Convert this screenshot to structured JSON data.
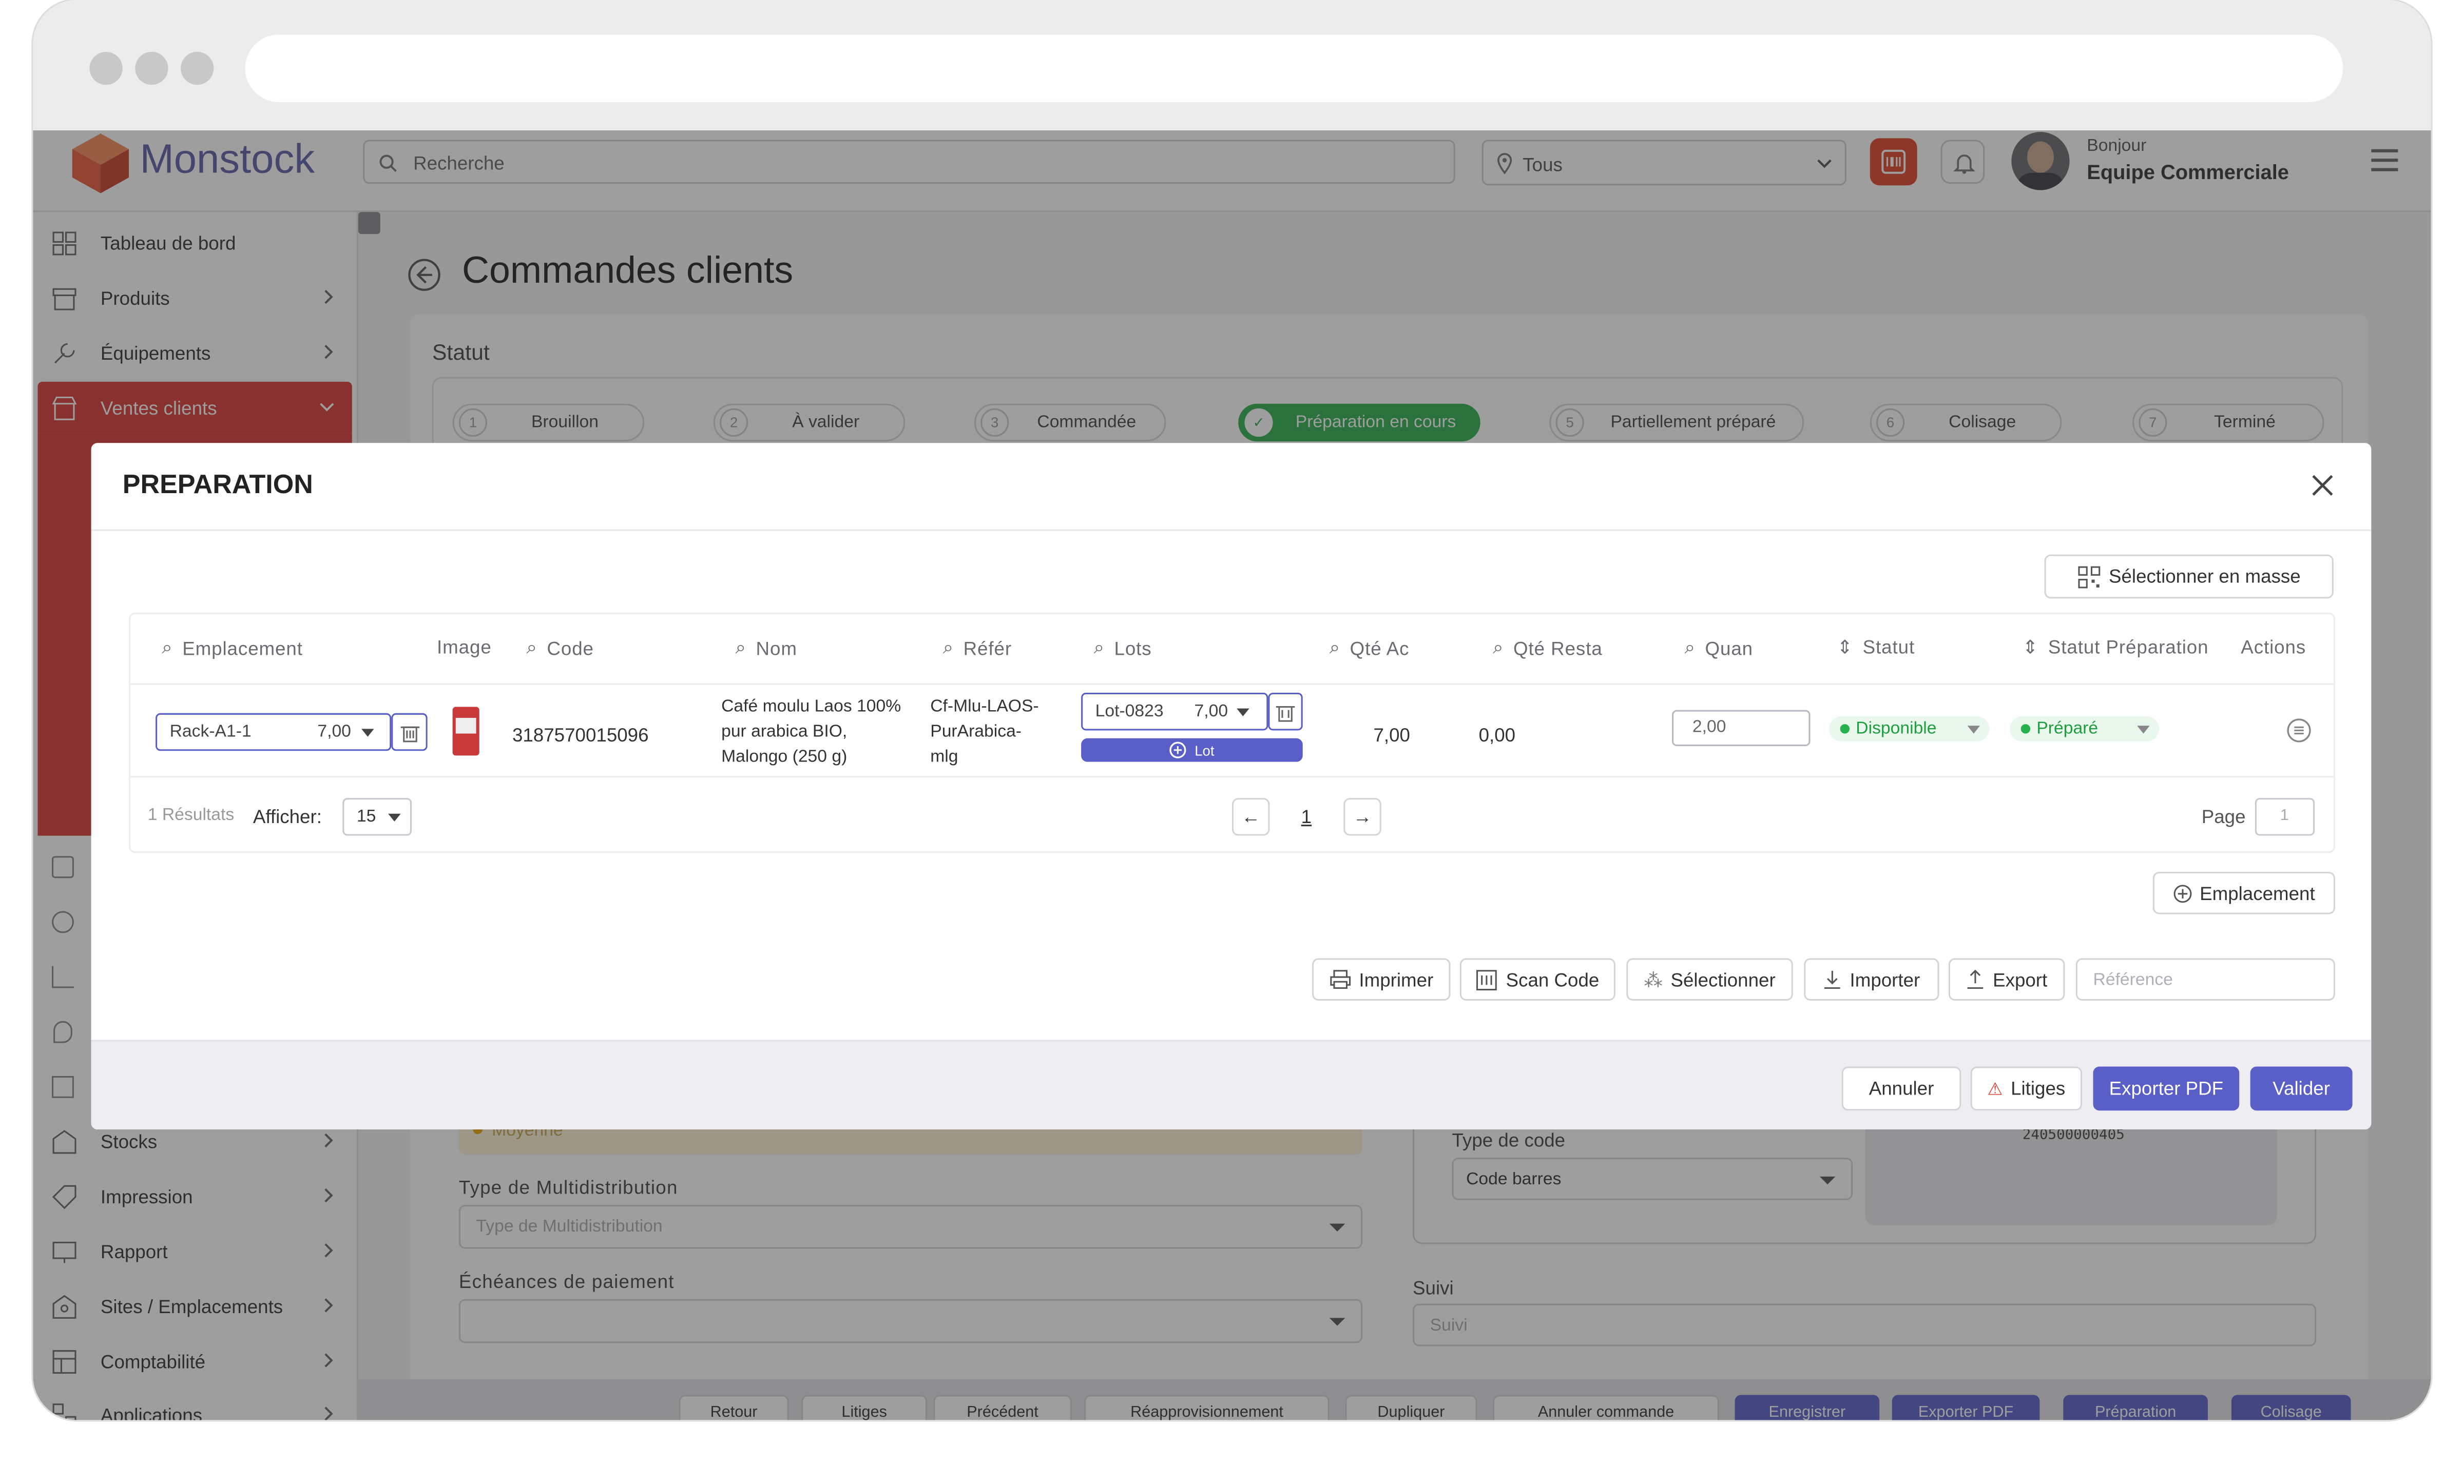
{
  "app": {
    "brand": "Monstock",
    "search_placeholder": "Recherche",
    "location_filter": "Tous",
    "greeting": "Bonjour",
    "user_name": "Equipe Commerciale"
  },
  "sidebar": {
    "items": [
      {
        "label": "Tableau de bord",
        "icon": "dashboard-icon"
      },
      {
        "label": "Produits",
        "icon": "box-icon"
      },
      {
        "label": "Équipements",
        "icon": "tools-icon"
      },
      {
        "label": "Ventes clients",
        "icon": "store-icon"
      },
      {
        "label": "Stocks",
        "icon": "warehouse-icon"
      },
      {
        "label": "Impression",
        "icon": "tag-icon"
      },
      {
        "label": "Rapport",
        "icon": "report-icon"
      },
      {
        "label": "Sites / Emplacements",
        "icon": "site-icon"
      },
      {
        "label": "Comptabilité",
        "icon": "accounting-icon"
      },
      {
        "label": "Applications",
        "icon": "apps-icon"
      }
    ]
  },
  "page": {
    "title": "Commandes clients",
    "status_label": "Statut"
  },
  "steps": [
    {
      "n": "1",
      "label": "Brouillon"
    },
    {
      "n": "2",
      "label": "À valider"
    },
    {
      "n": "3",
      "label": "Commandée"
    },
    {
      "n": "4",
      "label": "Préparation en cours"
    },
    {
      "n": "5",
      "label": "Partiellement préparé"
    },
    {
      "n": "6",
      "label": "Colisage"
    },
    {
      "n": "7",
      "label": "Terminé"
    }
  ],
  "background_form": {
    "priority_value": "Moyenne",
    "multi_label": "Type de Multidistribution",
    "multi_placeholder": "Type de Multidistribution",
    "echeances_label": "Échéances de paiement",
    "code_type_label": "Type de code",
    "code_type_value": "Code barres",
    "barcode_number": "240500000405",
    "suivi_label": "Suivi",
    "suivi_placeholder": "Suivi"
  },
  "bottom_bar": [
    "Retour",
    "Litiges",
    "Précédent",
    "Réapprovisionnement",
    "Dupliquer",
    "Annuler commande",
    "Enregistrer",
    "Exporter PDF",
    "Préparation",
    "Colisage"
  ],
  "modal": {
    "title": "PREPARATION",
    "select_mass": "Sélectionner en masse",
    "columns": {
      "emplacement": "Emplacement",
      "image": "Image",
      "code": "Code",
      "nom": "Nom",
      "refer": "Référ",
      "lots": "Lots",
      "qte_ac": "Qté Ac",
      "qte_resta": "Qté Resta",
      "quan": "Quan",
      "statut": "Statut",
      "statut_prep": "Statut Préparation",
      "actions": "Actions"
    },
    "row": {
      "emplacement": "Rack-A1-1",
      "emplacement_qty": "7,00",
      "code": "3187570015096",
      "nom_l1": "Café moulu Laos 100%",
      "nom_l2": "pur arabica BIO,",
      "nom_l3": "Malongo (250 g)",
      "ref_l1": "Cf-Mlu-LAOS-",
      "ref_l2": "PurArabica-",
      "ref_l3": "mlg",
      "lot": "Lot-0823",
      "lot_qty": "7,00",
      "lot_btn": "Lot",
      "qte_ac": "7,00",
      "qte_resta": "0,00",
      "quantity": "2,00",
      "statut": "Disponible",
      "statut_prep": "Préparé"
    },
    "results": "1 Résultats",
    "show_label": "Afficher:",
    "show_value": "15",
    "page_num": "1",
    "page_label": "Page",
    "page_input": "1",
    "emplacement_btn": "Emplacement",
    "actions": [
      "Imprimer",
      "Scan Code",
      "Sélectionner",
      "Importer",
      "Export"
    ],
    "reference_placeholder": "Référence",
    "footer": {
      "cancel": "Annuler",
      "litiges": "Litiges",
      "export_pdf": "Exporter PDF",
      "validate": "Valider"
    }
  },
  "colors": {
    "accent": "#5a5fc8",
    "brand_red": "#d93a33",
    "success": "#26b14a"
  }
}
